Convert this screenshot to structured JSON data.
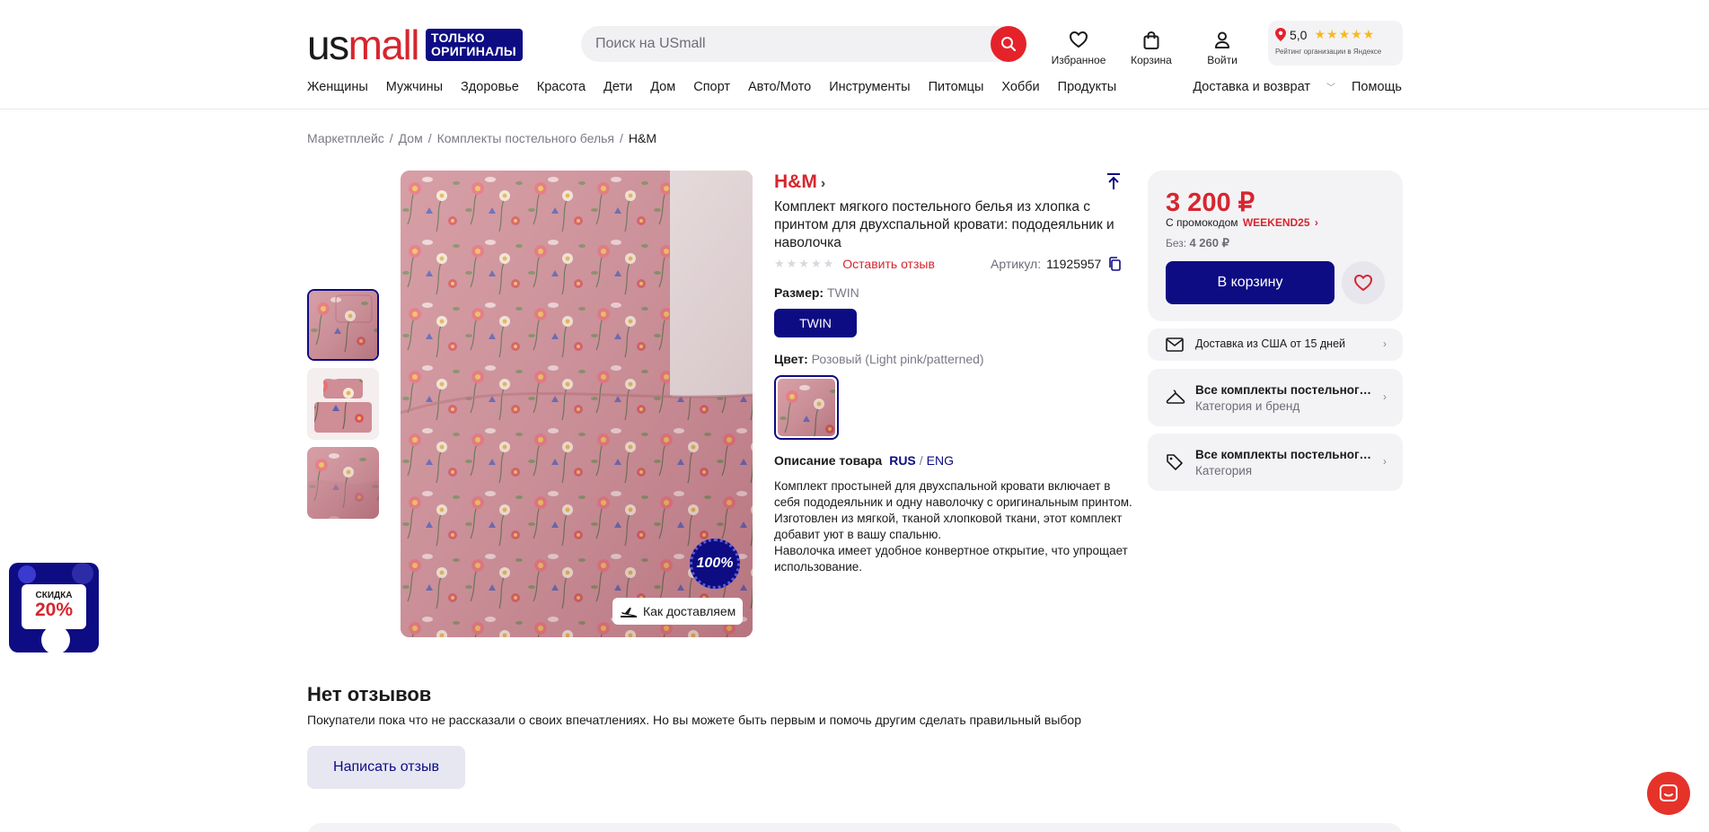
{
  "header": {
    "logo_us": "us",
    "logo_mall": "mall",
    "logo_badge_line1": "ТОЛЬКО",
    "logo_badge_line2": "ОРИГИНАЛЫ",
    "search_placeholder": "Поиск на USmall",
    "favorites_label": "Избранное",
    "cart_label": "Корзина",
    "login_label": "Войти",
    "rating_value": "5,0",
    "rating_stars": "★★★★★",
    "rating_caption": "Рейтинг организации в Яндексе"
  },
  "nav": {
    "categories": [
      "Женщины",
      "Мужчины",
      "Здоровье",
      "Красота",
      "Дети",
      "Дом",
      "Спорт",
      "Авто/Мото",
      "Инструменты",
      "Питомцы",
      "Хобби",
      "Продукты"
    ],
    "delivery": "Доставка и возврат",
    "help": "Помощь"
  },
  "breadcrumb": {
    "items": [
      "Маркетплейс",
      "Дом",
      "Комплекты постельного белья"
    ],
    "current": "H&M"
  },
  "gallery": {
    "badge": "100%",
    "how_deliver": "Как доставляем"
  },
  "product": {
    "brand": "H&M",
    "brand_chevron": "›",
    "title": "Комплект мягкого постельного белья из хлопка с принтом для двухспальной кровати: пододеяльник и наволочка",
    "stars": "★★★★★",
    "leave_review": "Оставить отзыв",
    "article_label": "Артикул:",
    "article_value": "11925957",
    "size_label": "Размер:",
    "size_value": "TWIN",
    "size_option": "TWIN",
    "color_label": "Цвет:",
    "color_value": "Розовый (Light pink/patterned)",
    "description_label": "Описание товара",
    "lang_rus": "RUS",
    "lang_sep": "/",
    "lang_eng": "ENG",
    "description": "Комплект простыней для двухспальной кровати включает в себя пододеяльник и одну наволочку с оригинальным принтом.\nИзготовлен из мягкой, тканой хлопковой ткани, этот комплект добавит уют в вашу спальню.\nНаволочка имеет удобное конвертное открытие, что упрощает использование."
  },
  "buy": {
    "price": "3 200 ₽",
    "promo_text": "С промокодом",
    "promo_code": "WEEKEND25",
    "promo_chevron": "›",
    "without_label": "Без:",
    "old_price": "4 260 ₽",
    "cart_button": "В корзину"
  },
  "info": {
    "delivery": "Доставка из США от 15 дней",
    "link1_title": "Все комплекты постельного белья H&M",
    "link1_sub": "Категория и бренд",
    "link2_title": "Все комплекты постельного белья",
    "link2_sub": "Категория",
    "chevron": "›"
  },
  "sale_float": {
    "line1": "СКИДКА",
    "line2": "20%"
  },
  "reviews": {
    "title": "Нет отзывов",
    "subtitle": "Покупатели пока что не рассказали о своих впечатлениях. Но вы можете быть первым и помочь другим сделать правильный выбор",
    "write_button": "Написать отзыв"
  },
  "colors": {
    "brand_red": "#d6262f",
    "brand_navy": "#0e0c83",
    "panel_grey": "#f3f3f6"
  }
}
